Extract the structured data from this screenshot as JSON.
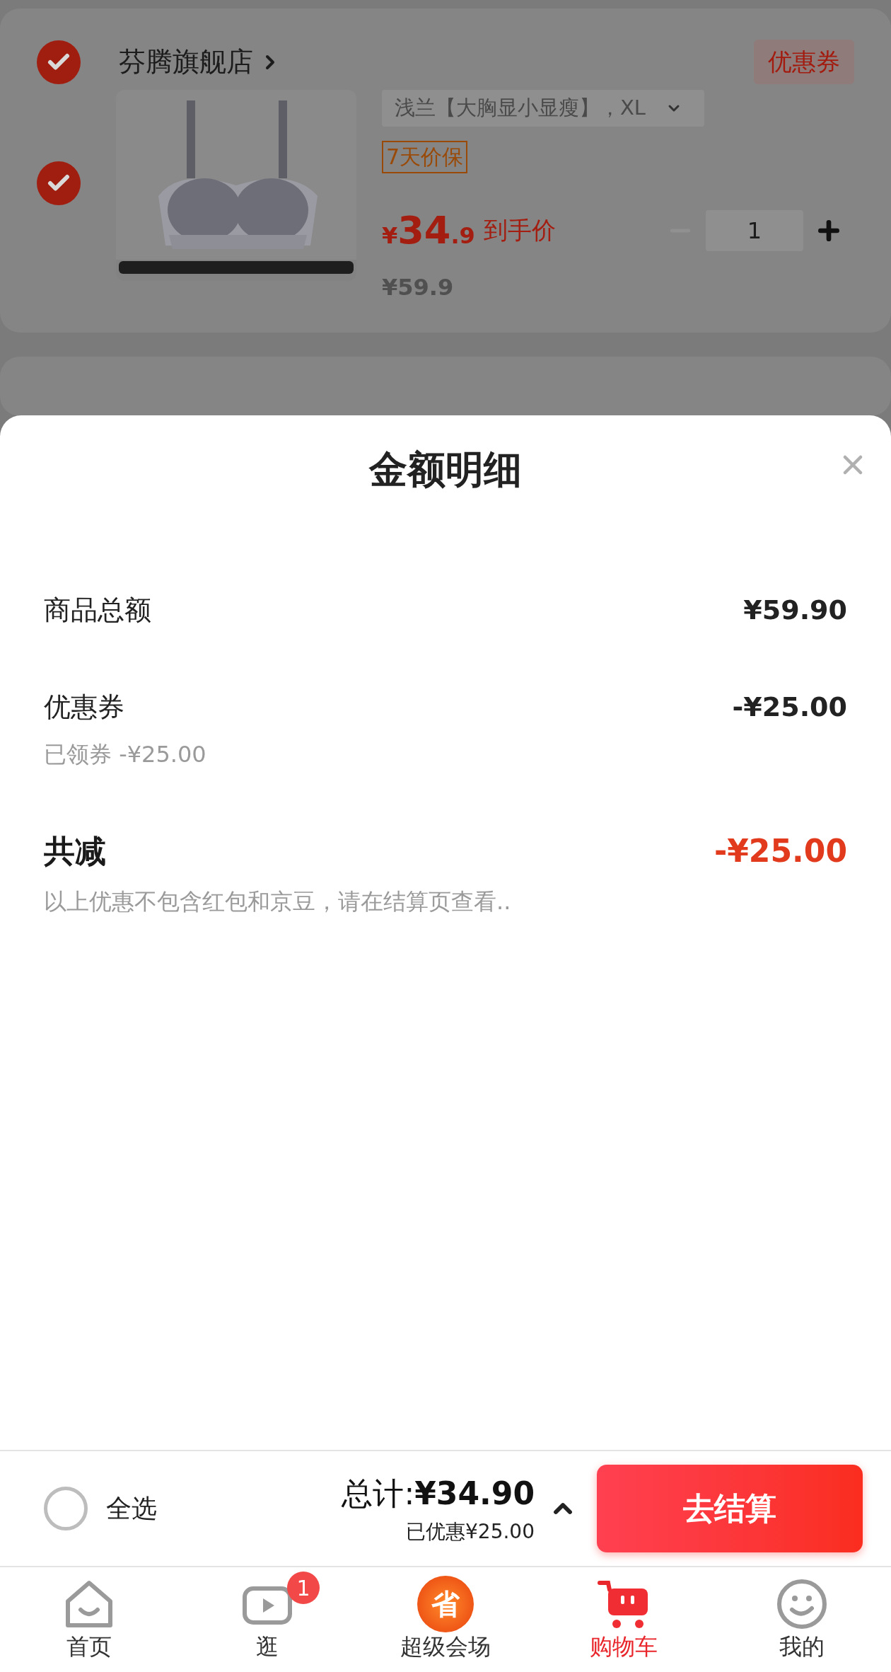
{
  "cart": {
    "stores": [
      {
        "name": "芬腾旗舰店",
        "checked": true,
        "coupon": "优惠券",
        "items": [
          {
            "checked": true,
            "variant": "浅兰【大胸显小显瘦】，XL",
            "tag": "7天价保",
            "currency": "¥",
            "price_int": "34",
            "price_dec": ".9",
            "price_label": "到手价",
            "original_price": "¥59.9",
            "quantity": "1",
            "can_decrease": false
          }
        ]
      }
    ]
  },
  "sheet": {
    "title": "金额明细",
    "rows": [
      {
        "kind": "normal",
        "label": "商品总额",
        "amount": "¥59.90"
      },
      {
        "kind": "normal",
        "label": "优惠券",
        "amount": "-¥25.00",
        "sub": "已领券 -¥25.00"
      },
      {
        "kind": "total",
        "label": "共减",
        "amount": "-¥25.00",
        "note": "以上优惠不包含红包和京豆，请在结算页查看.."
      }
    ]
  },
  "checkout_bar": {
    "select_all": {
      "label": "全选",
      "checked": false
    },
    "total": "总计:**¥34.90**",
    "saved": "已优惠¥25.00",
    "button": "去结算"
  },
  "tab_bar": [
    {
      "kind": "home",
      "label": "首页",
      "selected": false
    },
    {
      "kind": "video",
      "label": "逛",
      "selected": false,
      "badge": "1"
    },
    {
      "kind": "sale",
      "label": "超级会场",
      "selected": false,
      "icon_text": "省"
    },
    {
      "kind": "cart",
      "label": "购物车",
      "selected": true
    },
    {
      "kind": "profile",
      "label": "我的",
      "selected": false
    }
  ]
}
